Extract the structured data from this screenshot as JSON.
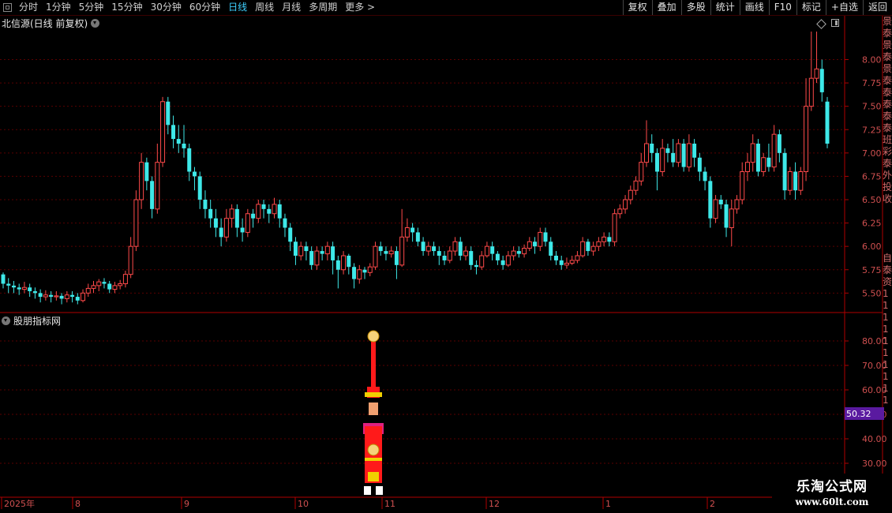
{
  "toolbar": {
    "periods": [
      {
        "label": "分时",
        "active": false
      },
      {
        "label": "1分钟",
        "active": false
      },
      {
        "label": "5分钟",
        "active": false
      },
      {
        "label": "15分钟",
        "active": false
      },
      {
        "label": "30分钟",
        "active": false
      },
      {
        "label": "60分钟",
        "active": false
      },
      {
        "label": "日线",
        "active": true
      },
      {
        "label": "周线",
        "active": false
      },
      {
        "label": "月线",
        "active": false
      },
      {
        "label": "多周期",
        "active": false
      },
      {
        "label": "更多 >",
        "active": false
      }
    ],
    "actions": [
      "复权",
      "叠加",
      "多股",
      "统计",
      "画线",
      "F10",
      "标记",
      "+自选",
      "返回"
    ]
  },
  "main_panel": {
    "title": "北信源(日线 前复权)",
    "y_ticks": [
      "8.00",
      "7.75",
      "7.50",
      "7.25",
      "7.00",
      "6.75",
      "6.50",
      "6.25",
      "6.00",
      "5.75",
      "5.50"
    ]
  },
  "sub_panel": {
    "title": "股朋指标网",
    "y_ticks": [
      "80.00",
      "70.00",
      "60.00",
      "50.00",
      "40.00",
      "30.00"
    ],
    "current_value": "50.32"
  },
  "x_axis": {
    "labels": [
      "2025年",
      "8",
      "9",
      "10",
      "11",
      "12",
      "1",
      "2"
    ]
  },
  "right_strip": [
    "景",
    "泰",
    "景",
    "泰",
    "景",
    "泰",
    "泰",
    "泰",
    "泰",
    "泰",
    "班",
    "彩",
    "泰",
    "外",
    "投",
    "收",
    "",
    "",
    "",
    "",
    "自",
    "泰",
    "资",
    "1",
    "1",
    "1",
    "1",
    "1",
    "1",
    "1",
    "1",
    "1",
    "1"
  ],
  "watermark": {
    "title": "乐淘公式网",
    "url": "www.60lt.com"
  },
  "colors": {
    "up": "#ff4a4a",
    "down": "#3ee8e8",
    "grid": "#5a0000",
    "axis": "#b00000",
    "active_tab": "#3fd0ff",
    "value_badge": "#5a1aa0"
  },
  "chart_data": {
    "type": "candlestick",
    "title": "北信源(日线 前复权)",
    "ylim": [
      5.3,
      8.3
    ],
    "candles": [
      [
        5.7,
        5.6,
        5.72,
        5.55
      ],
      [
        5.6,
        5.58,
        5.66,
        5.5
      ],
      [
        5.58,
        5.56,
        5.63,
        5.5
      ],
      [
        5.56,
        5.54,
        5.6,
        5.48
      ],
      [
        5.54,
        5.56,
        5.62,
        5.5
      ],
      [
        5.56,
        5.52,
        5.6,
        5.46
      ],
      [
        5.52,
        5.5,
        5.56,
        5.44
      ],
      [
        5.5,
        5.46,
        5.54,
        5.4
      ],
      [
        5.46,
        5.48,
        5.53,
        5.42
      ],
      [
        5.48,
        5.46,
        5.52,
        5.4
      ],
      [
        5.46,
        5.47,
        5.52,
        5.42
      ],
      [
        5.47,
        5.44,
        5.5,
        5.38
      ],
      [
        5.44,
        5.48,
        5.52,
        5.4
      ],
      [
        5.48,
        5.46,
        5.52,
        5.4
      ],
      [
        5.46,
        5.42,
        5.5,
        5.38
      ],
      [
        5.42,
        5.5,
        5.54,
        5.4
      ],
      [
        5.5,
        5.55,
        5.6,
        5.46
      ],
      [
        5.55,
        5.58,
        5.63,
        5.5
      ],
      [
        5.58,
        5.62,
        5.65,
        5.52
      ],
      [
        5.62,
        5.6,
        5.66,
        5.55
      ],
      [
        5.6,
        5.54,
        5.63,
        5.5
      ],
      [
        5.54,
        5.58,
        5.62,
        5.5
      ],
      [
        5.58,
        5.6,
        5.64,
        5.54
      ],
      [
        5.6,
        5.7,
        5.74,
        5.56
      ],
      [
        5.7,
        6.0,
        6.1,
        5.66
      ],
      [
        6.0,
        6.5,
        6.6,
        5.95
      ],
      [
        6.5,
        6.9,
        7.0,
        6.4
      ],
      [
        6.9,
        6.7,
        6.95,
        6.6
      ],
      [
        6.7,
        6.4,
        6.75,
        6.3
      ],
      [
        6.4,
        6.9,
        7.1,
        6.35
      ],
      [
        6.9,
        7.55,
        7.6,
        6.85
      ],
      [
        7.55,
        7.3,
        7.6,
        7.2
      ],
      [
        7.3,
        7.15,
        7.4,
        7.05
      ],
      [
        7.15,
        7.1,
        7.3,
        7.0
      ],
      [
        7.1,
        7.05,
        7.3,
        6.95
      ],
      [
        7.05,
        6.8,
        7.1,
        6.7
      ],
      [
        6.8,
        6.75,
        6.85,
        6.6
      ],
      [
        6.75,
        6.5,
        6.8,
        6.4
      ],
      [
        6.5,
        6.4,
        6.6,
        6.3
      ],
      [
        6.4,
        6.3,
        6.5,
        6.2
      ],
      [
        6.3,
        6.2,
        6.4,
        6.1
      ],
      [
        6.2,
        6.1,
        6.3,
        6.0
      ],
      [
        6.1,
        6.3,
        6.4,
        6.05
      ],
      [
        6.3,
        6.4,
        6.45,
        6.2
      ],
      [
        6.4,
        6.2,
        6.45,
        6.1
      ],
      [
        6.2,
        6.15,
        6.3,
        6.05
      ],
      [
        6.15,
        6.35,
        6.4,
        6.1
      ],
      [
        6.35,
        6.3,
        6.4,
        6.2
      ],
      [
        6.3,
        6.45,
        6.5,
        6.25
      ],
      [
        6.45,
        6.4,
        6.5,
        6.3
      ],
      [
        6.4,
        6.35,
        6.45,
        6.25
      ],
      [
        6.35,
        6.45,
        6.52,
        6.3
      ],
      [
        6.45,
        6.3,
        6.5,
        6.2
      ],
      [
        6.3,
        6.2,
        6.35,
        6.1
      ],
      [
        6.2,
        6.05,
        6.25,
        5.95
      ],
      [
        6.05,
        5.9,
        6.1,
        5.8
      ],
      [
        5.9,
        6.0,
        6.05,
        5.85
      ],
      [
        6.0,
        5.95,
        6.05,
        5.85
      ],
      [
        5.95,
        5.8,
        6.0,
        5.75
      ],
      [
        5.8,
        5.95,
        6.0,
        5.75
      ],
      [
        5.95,
        5.92,
        6.0,
        5.85
      ],
      [
        5.92,
        6.0,
        6.05,
        5.85
      ],
      [
        6.0,
        5.85,
        6.05,
        5.7
      ],
      [
        5.85,
        5.75,
        5.9,
        5.55
      ],
      [
        5.75,
        5.9,
        5.95,
        5.7
      ],
      [
        5.9,
        5.78,
        5.92,
        5.7
      ],
      [
        5.78,
        5.65,
        5.82,
        5.55
      ],
      [
        5.65,
        5.75,
        5.8,
        5.6
      ],
      [
        5.75,
        5.72,
        5.78,
        5.65
      ],
      [
        5.72,
        5.78,
        5.82,
        5.68
      ],
      [
        5.78,
        6.0,
        6.05,
        5.75
      ],
      [
        6.0,
        5.95,
        6.05,
        5.9
      ],
      [
        5.95,
        5.92,
        6.0,
        5.85
      ],
      [
        5.92,
        5.95,
        6.0,
        5.88
      ],
      [
        5.95,
        5.8,
        6.0,
        5.65
      ],
      [
        5.8,
        6.1,
        6.4,
        5.78
      ],
      [
        6.1,
        6.2,
        6.3,
        6.05
      ],
      [
        6.2,
        6.15,
        6.25,
        6.05
      ],
      [
        6.15,
        6.05,
        6.2,
        6.0
      ],
      [
        6.05,
        5.95,
        6.1,
        5.9
      ],
      [
        5.95,
        6.0,
        6.05,
        5.9
      ],
      [
        6.0,
        5.95,
        6.05,
        5.9
      ],
      [
        5.95,
        5.9,
        6.0,
        5.8
      ],
      [
        5.9,
        5.85,
        5.95,
        5.8
      ],
      [
        5.85,
        5.95,
        6.0,
        5.82
      ],
      [
        5.95,
        6.05,
        6.1,
        5.9
      ],
      [
        6.05,
        5.9,
        6.1,
        5.85
      ],
      [
        5.9,
        5.95,
        6.0,
        5.85
      ],
      [
        5.95,
        5.8,
        6.0,
        5.75
      ],
      [
        5.8,
        5.78,
        5.85,
        5.7
      ],
      [
        5.78,
        5.9,
        5.95,
        5.75
      ],
      [
        5.9,
        6.0,
        6.05,
        5.88
      ],
      [
        6.0,
        5.92,
        6.05,
        5.85
      ],
      [
        5.92,
        5.85,
        5.95,
        5.8
      ],
      [
        5.85,
        5.8,
        5.9,
        5.75
      ],
      [
        5.8,
        5.9,
        5.95,
        5.78
      ],
      [
        5.9,
        5.95,
        6.0,
        5.85
      ],
      [
        5.95,
        5.92,
        6.0,
        5.88
      ],
      [
        5.92,
        5.98,
        6.02,
        5.88
      ],
      [
        5.98,
        6.05,
        6.1,
        5.95
      ],
      [
        6.05,
        6.0,
        6.1,
        5.92
      ],
      [
        6.0,
        6.15,
        6.2,
        5.95
      ],
      [
        6.15,
        6.05,
        6.2,
        6.0
      ],
      [
        6.05,
        5.9,
        6.1,
        5.85
      ],
      [
        5.9,
        5.85,
        5.95,
        5.8
      ],
      [
        5.85,
        5.8,
        5.9,
        5.75
      ],
      [
        5.8,
        5.82,
        5.88,
        5.76
      ],
      [
        5.82,
        5.85,
        5.9,
        5.8
      ],
      [
        5.85,
        5.9,
        5.95,
        5.82
      ],
      [
        5.9,
        6.05,
        6.1,
        5.88
      ],
      [
        6.05,
        5.95,
        6.08,
        5.9
      ],
      [
        5.95,
        6.0,
        6.05,
        5.9
      ],
      [
        6.0,
        6.05,
        6.1,
        5.95
      ],
      [
        6.05,
        6.1,
        6.15,
        6.0
      ],
      [
        6.1,
        6.05,
        6.15,
        6.0
      ],
      [
        6.05,
        6.35,
        6.4,
        6.0
      ],
      [
        6.35,
        6.4,
        6.45,
        6.3
      ],
      [
        6.4,
        6.5,
        6.55,
        6.35
      ],
      [
        6.5,
        6.6,
        6.65,
        6.45
      ],
      [
        6.6,
        6.7,
        6.75,
        6.55
      ],
      [
        6.7,
        6.9,
        7.0,
        6.65
      ],
      [
        6.9,
        7.1,
        7.35,
        6.85
      ],
      [
        7.1,
        7.0,
        7.2,
        6.9
      ],
      [
        7.0,
        6.8,
        7.05,
        6.6
      ],
      [
        6.8,
        7.05,
        7.15,
        6.75
      ],
      [
        7.05,
        7.0,
        7.1,
        6.9
      ],
      [
        7.0,
        6.9,
        7.15,
        6.85
      ],
      [
        6.9,
        7.1,
        7.15,
        6.85
      ],
      [
        7.1,
        6.85,
        7.15,
        6.8
      ],
      [
        6.85,
        7.1,
        7.2,
        6.8
      ],
      [
        7.1,
        6.95,
        7.15,
        6.85
      ],
      [
        6.95,
        6.8,
        7.0,
        6.7
      ],
      [
        6.8,
        6.7,
        6.85,
        6.6
      ],
      [
        6.7,
        6.3,
        6.75,
        6.2
      ],
      [
        6.3,
        6.5,
        6.55,
        6.25
      ],
      [
        6.5,
        6.45,
        6.55,
        6.4
      ],
      [
        6.45,
        6.2,
        6.5,
        6.1
      ],
      [
        6.2,
        6.4,
        6.5,
        6.0
      ],
      [
        6.4,
        6.5,
        6.55,
        6.35
      ],
      [
        6.5,
        6.8,
        6.9,
        6.45
      ],
      [
        6.8,
        6.9,
        7.0,
        6.7
      ],
      [
        6.9,
        7.1,
        7.2,
        6.8
      ],
      [
        7.1,
        6.8,
        7.15,
        6.75
      ],
      [
        6.8,
        6.95,
        7.0,
        6.75
      ],
      [
        6.95,
        6.85,
        7.1,
        6.8
      ],
      [
        6.85,
        7.2,
        7.3,
        6.8
      ],
      [
        7.2,
        7.0,
        7.25,
        6.9
      ],
      [
        7.0,
        6.6,
        7.05,
        6.5
      ],
      [
        6.6,
        6.8,
        6.85,
        6.55
      ],
      [
        6.8,
        6.6,
        6.9,
        6.5
      ],
      [
        6.6,
        6.8,
        6.85,
        6.55
      ],
      [
        6.8,
        7.5,
        7.8,
        6.7
      ],
      [
        7.5,
        7.8,
        8.3,
        7.45
      ],
      [
        7.8,
        7.9,
        8.3,
        7.75
      ],
      [
        7.9,
        7.65,
        8.0,
        7.55
      ],
      [
        7.55,
        7.1,
        7.6,
        7.05
      ]
    ]
  }
}
